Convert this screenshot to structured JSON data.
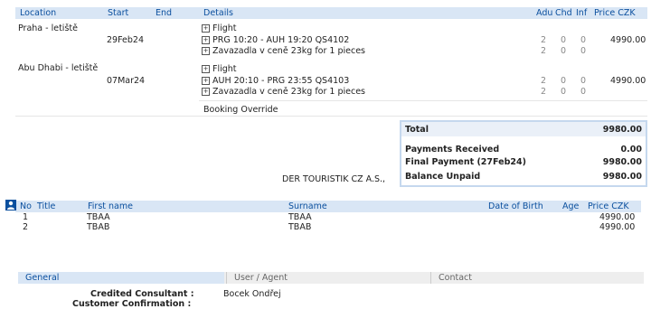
{
  "segments_header": {
    "location": "Location",
    "start": "Start",
    "end": "End",
    "details": "Details",
    "adu": "Adu",
    "chd": "Chd",
    "inf": "Inf",
    "price": "Price CZK"
  },
  "segments": [
    {
      "location": "Praha - letiště",
      "start": "29Feb24",
      "lines": [
        "Flight",
        "PRG 10:20 - AUH 19:20 QS4102",
        "Zavazadla v ceně 23kg for 1 pieces"
      ],
      "counts": [
        [
          "2",
          "0",
          "0"
        ],
        [
          "2",
          "0",
          "0"
        ]
      ],
      "price": "4990.00"
    },
    {
      "location": "Abu Dhabi - letiště",
      "start": "07Mar24",
      "lines": [
        "Flight",
        "AUH 20:10 - PRG 23:55 QS4103",
        "Zavazadla v ceně 23kg for 1 pieces"
      ],
      "counts": [
        [
          "2",
          "0",
          "0"
        ],
        [
          "2",
          "0",
          "0"
        ]
      ],
      "price": "4990.00"
    }
  ],
  "booking_override": "Booking Override",
  "totals": {
    "total_label": "Total",
    "total_value": "9980.00",
    "payments_label": "Payments Received",
    "payments_value": "0.00",
    "final_label": "Final Payment (27Feb24)",
    "final_value": "9980.00",
    "balance_label": "Balance Unpaid",
    "balance_value": "9980.00"
  },
  "company": "DER TOURISTIK CZ A.S.,",
  "passengers_header": {
    "no": "No",
    "title": "Title",
    "first": "First name",
    "surname": "Surname",
    "dob": "Date of Birth",
    "age": "Age",
    "price": "Price CZK"
  },
  "passengers": [
    {
      "no": "1",
      "first": "TBAA",
      "surname": "TBAA",
      "price": "4990.00"
    },
    {
      "no": "2",
      "first": "TBAB",
      "surname": "TBAB",
      "price": "4990.00"
    }
  ],
  "tabs": [
    "General",
    "User / Agent",
    "Contact"
  ],
  "general": {
    "consultant_label": "Credited Consultant :",
    "consultant_value": "Bocek Ondřej",
    "confirmation_label": "Customer Confirmation :"
  }
}
